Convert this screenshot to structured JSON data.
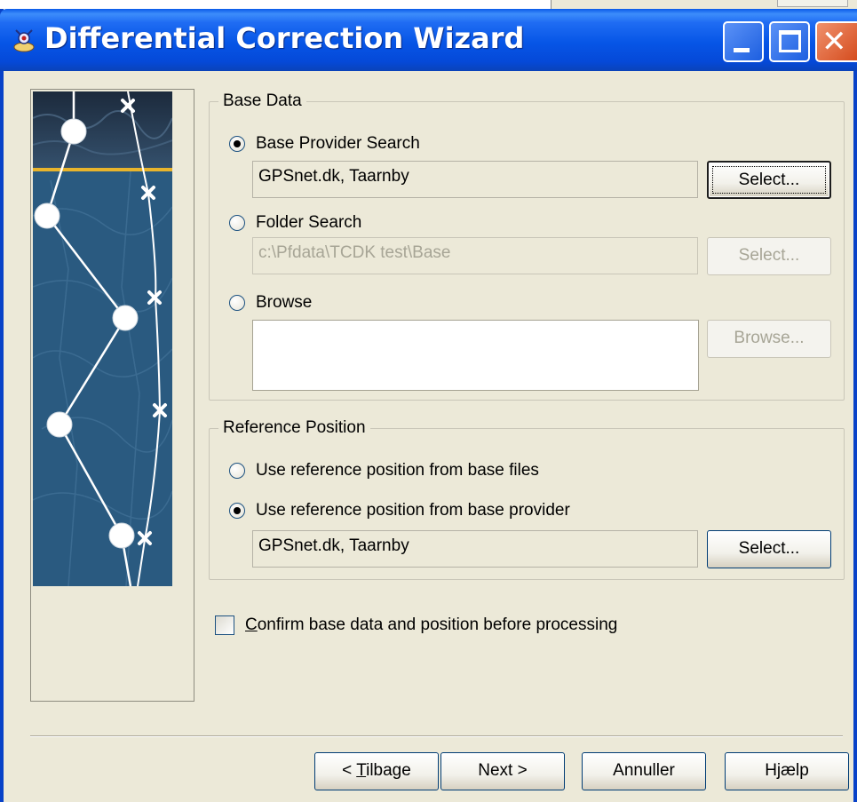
{
  "window": {
    "title": "Differential Correction Wizard"
  },
  "base_data": {
    "legend": "Base Data",
    "provider_search": {
      "label": "Base Provider Search",
      "value": "GPSnet.dk, Taarnby",
      "button": "Select..."
    },
    "folder_search": {
      "label": "Folder Search",
      "value": "c:\\Pfdata\\TCDK test\\Base",
      "button": "Select..."
    },
    "browse": {
      "label": "Browse",
      "value": "",
      "button": "Browse..."
    }
  },
  "reference_position": {
    "legend": "Reference Position",
    "from_files_label": "Use reference position from base files",
    "from_provider_label": "Use reference position from base provider",
    "provider_value": "GPSnet.dk, Taarnby",
    "button": "Select..."
  },
  "confirm": {
    "label_first": "C",
    "label_rest": "onfirm base data and position before processing"
  },
  "footer": {
    "back_prefix": "< ",
    "back_key": "T",
    "back_rest": "ilbage",
    "next": "Next >",
    "cancel": "Annuller",
    "help": "Hjælp"
  },
  "colors": {
    "title_bar": "#0655e6",
    "window_face": "#ece9d8",
    "sidebar_art": "#2a5a80",
    "accent_stripe": "#e8b42c"
  }
}
